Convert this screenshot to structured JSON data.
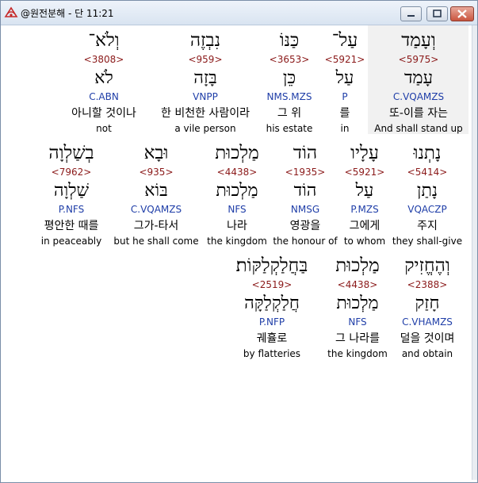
{
  "window": {
    "title": "@원전분해 - 단 11:21",
    "buttons": {
      "minimize": "minimize",
      "maximize": "maximize",
      "close": "close"
    }
  },
  "rows": [
    {
      "words": [
        {
          "hebrew": "וְעָמַד",
          "strong": "<5975>",
          "lemma": "עָמַד",
          "morph": "C.VQAMZS",
          "korean": "또-이를 자는",
          "english": "And shall stand up",
          "selected": true
        },
        {
          "hebrew": "עַל־",
          "strong": "<5921>",
          "lemma": "עַל",
          "morph": "P",
          "korean": "를",
          "english": "in"
        },
        {
          "hebrew": "כַּנּוֹ",
          "strong": "<3653>",
          "lemma": "כֵּן",
          "morph": "NMS.MZS",
          "korean": "그 위",
          "english": "his estate"
        },
        {
          "hebrew": "נִבְזֶה",
          "strong": "<959>",
          "lemma": "בָּזָה",
          "morph": "VNPP",
          "korean": "한 비천한 사람이라",
          "english": "a vile person"
        },
        {
          "hebrew": "וְלֹא־",
          "strong": "<3808>",
          "lemma": "לֹא",
          "morph": "C.ABN",
          "korean": "아니할 것이나",
          "english": "not"
        }
      ]
    },
    {
      "words": [
        {
          "hebrew": "נָתְנוּ",
          "strong": "<5414>",
          "lemma": "נָתַן",
          "morph": "VQACZP",
          "korean": "주지",
          "english": "they shall-give"
        },
        {
          "hebrew": "עָלָיו",
          "strong": "<5921>",
          "lemma": "עַל",
          "morph": "P.MZS",
          "korean": "그에게",
          "english": "to whom"
        },
        {
          "hebrew": "הוֹד",
          "strong": "<1935>",
          "lemma": "הוֹד",
          "morph": "NMSG",
          "korean": "영광을",
          "english": "the honour of"
        },
        {
          "hebrew": "מַלְכוּת",
          "strong": "<4438>",
          "lemma": "מַלְכוּת",
          "morph": "NFS",
          "korean": "나라",
          "english": "the kingdom"
        },
        {
          "hebrew": "וּבָא",
          "strong": "<935>",
          "lemma": "בּוֹא",
          "morph": "C.VQAMZS",
          "korean": "그가-타서",
          "english": "but he shall come"
        },
        {
          "hebrew": "בְשַׁלְוָה",
          "strong": "<7962>",
          "lemma": "שַׁלְוָה",
          "morph": "P.NFS",
          "korean": "평안한 때를",
          "english": "in peaceably"
        }
      ]
    },
    {
      "words": [
        {
          "hebrew": "וְהֶחֱזִיק",
          "strong": "<2388>",
          "lemma": "חָזַק",
          "morph": "C.VHAMZS",
          "korean": "덜을 것이며",
          "english": "and obtain"
        },
        {
          "hebrew": "מַלְכוּת",
          "strong": "<4438>",
          "lemma": "מַלְכוּת",
          "morph": "NFS",
          "korean": "그 나라를",
          "english": "the kingdom"
        },
        {
          "hebrew": "בַּחֲלַקְלַקּוֹת׃",
          "strong": "<2519>",
          "lemma": "חֲלַקְלַקָּה",
          "morph": "P.NFP",
          "korean": "궤휼로",
          "english": "by flatteries"
        }
      ]
    }
  ]
}
